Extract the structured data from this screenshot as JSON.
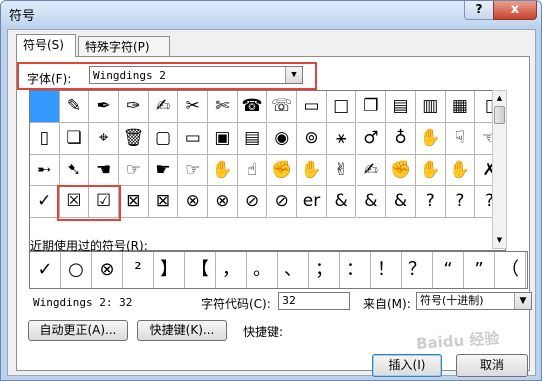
{
  "window": {
    "title": "符号"
  },
  "titlebar": {
    "help_label": "?",
    "close_label": "x"
  },
  "tabs": [
    {
      "label": "符号(S)"
    },
    {
      "label": "特殊字符(P)"
    }
  ],
  "font": {
    "label": "字体(F):",
    "value": "Wingdings 2"
  },
  "symbols": [
    "",
    "✎",
    "✒",
    "✑",
    "✍",
    "✂",
    "✄",
    "☎",
    "☏",
    "▭",
    "□",
    "❐",
    "▤",
    "▥",
    "▦",
    "▯",
    "▯",
    "❏",
    "⌖",
    "🗑",
    "▢",
    "▭",
    "▣",
    "▤",
    "◉",
    "⊚",
    "⚹",
    "♂",
    "♁",
    "✋",
    "☟",
    "☜",
    "➸",
    "➷",
    "☚",
    "☞",
    "☛",
    "☞",
    "✋",
    "☝",
    "✊",
    "✋",
    "✌",
    "✍",
    "✊",
    "✋",
    "✋",
    "✗",
    "✓",
    "☒",
    "☑",
    "⊠",
    "⊠",
    "⊗",
    "⊗",
    "⊘",
    "⊘",
    "er",
    "&",
    "&",
    "&",
    "?",
    "?",
    "?"
  ],
  "recent": {
    "label": "近期使用过的符号(R):",
    "items": [
      "✓",
      "○",
      "⊗",
      "²",
      "】",
      "【",
      "，",
      "。",
      "、",
      "；",
      "：",
      "！",
      "？",
      "“",
      "”",
      "（"
    ]
  },
  "info": {
    "name": "Wingdings 2: 32",
    "code_label": "字符代码(C):",
    "code_value": "32",
    "from_label": "来自(M):",
    "from_value": "符号(十进制)"
  },
  "buttons": {
    "autocorrect": "自动更正(A)...",
    "shortcut_key": "快捷键(K)...",
    "shortcut_label": "快捷键:",
    "insert": "插入(I)",
    "cancel": "取消"
  },
  "watermark": "Baidu 经验"
}
